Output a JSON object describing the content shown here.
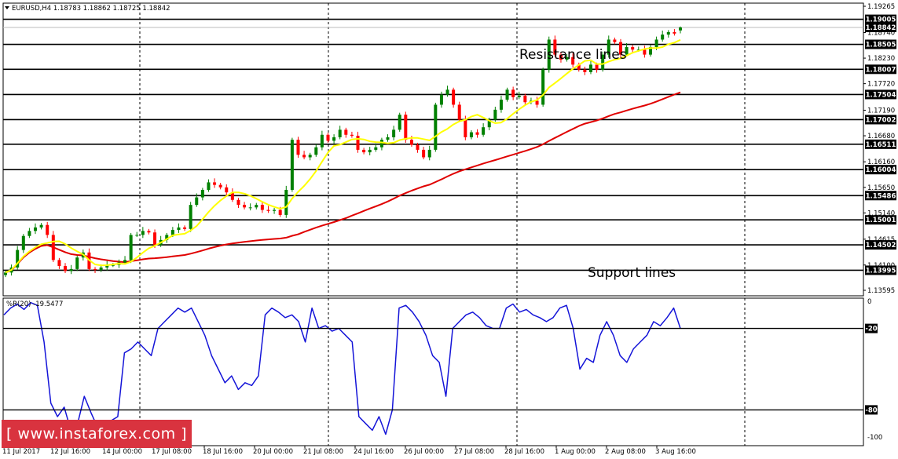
{
  "header": {
    "symbol_line": "EURUSD,H4  1.18783 1.18862 1.18725 1.18842"
  },
  "indicator": {
    "label": "%R(20) -19.5477"
  },
  "annotations": {
    "resistance": "Resistance lines",
    "support": "Support lines"
  },
  "watermark": {
    "text": "[  www.instaforex.com ]"
  },
  "colors": {
    "candle_up": "#008000",
    "candle_down": "#ff0000",
    "ma_fast": "#ffff00",
    "ma_slow": "#e00000",
    "wpr": "#1414d8",
    "watermark_bg": "#d9333f"
  },
  "chart_data": {
    "type": "candlestick",
    "symbol": "EURUSD",
    "timeframe": "H4",
    "last_ohlc": [
      1.18783,
      1.18862,
      1.18725,
      1.18842
    ],
    "ylim": [
      1.13595,
      1.19265
    ],
    "y_ticks": [
      1.19265,
      1.1874,
      1.1823,
      1.1772,
      1.1719,
      1.1668,
      1.1616,
      1.1565,
      1.1514,
      1.14615,
      1.141,
      1.13595
    ],
    "x_ticks": [
      "11 Jul 2017",
      "12 Jul 16:00",
      "14 Jul 00:00",
      "17 Jul 08:00",
      "18 Jul 16:00",
      "20 Jul 00:00",
      "21 Jul 08:00",
      "24 Jul 16:00",
      "26 Jul 00:00",
      "27 Jul 08:00",
      "28 Jul 16:00",
      "1 Aug 00:00",
      "2 Aug 08:00",
      "3 Aug 16:00"
    ],
    "levels": [
      1.19005,
      1.18842,
      1.18505,
      1.18007,
      1.17504,
      1.17002,
      1.16511,
      1.16004,
      1.15486,
      1.15001,
      1.14502,
      1.13995
    ],
    "close": [
      1.1395,
      1.1405,
      1.144,
      1.1468,
      1.1478,
      1.1485,
      1.149,
      1.147,
      1.142,
      1.1408,
      1.1398,
      1.1402,
      1.1425,
      1.1435,
      1.1402,
      1.14,
      1.1405,
      1.141,
      1.141,
      1.1415,
      1.142,
      1.147,
      1.147,
      1.1478,
      1.1475,
      1.145,
      1.146,
      1.147,
      1.148,
      1.1485,
      1.1482,
      1.153,
      1.1545,
      1.156,
      1.1575,
      1.157,
      1.1565,
      1.1555,
      1.154,
      1.153,
      1.1525,
      1.1525,
      1.153,
      1.152,
      1.1518,
      1.152,
      1.151,
      1.156,
      1.166,
      1.163,
      1.1625,
      1.163,
      1.1645,
      1.167,
      1.1658,
      1.1665,
      1.168,
      1.167,
      1.1668,
      1.164,
      1.1635,
      1.164,
      1.1645,
      1.166,
      1.1665,
      1.168,
      1.171,
      1.166,
      1.165,
      1.164,
      1.1625,
      1.164,
      1.173,
      1.175,
      1.176,
      1.173,
      1.17,
      1.1665,
      1.1675,
      1.167,
      1.1685,
      1.17,
      1.172,
      1.174,
      1.176,
      1.1745,
      1.1748,
      1.1735,
      1.1738,
      1.173,
      1.18,
      1.186,
      1.183,
      1.182,
      1.1825,
      1.181,
      1.18,
      1.1795,
      1.181,
      1.18,
      1.183,
      1.186,
      1.1855,
      1.183,
      1.1845,
      1.184,
      1.184,
      1.183,
      1.1845,
      1.186,
      1.187,
      1.1875,
      1.1872,
      1.18842
    ],
    "wpr": [
      -10,
      -5,
      -2,
      -6,
      -1,
      -3,
      -30,
      -75,
      -85,
      -78,
      -95,
      -90,
      -70,
      -82,
      -93,
      -92,
      -88,
      -85,
      -38,
      -35,
      -30,
      -35,
      -40,
      -20,
      -15,
      -10,
      -5,
      -8,
      -5,
      -15,
      -25,
      -40,
      -50,
      -60,
      -55,
      -65,
      -60,
      -62,
      -55,
      -10,
      -5,
      -8,
      -12,
      -10,
      -15,
      -30,
      -5,
      -20,
      -18,
      -22,
      -20,
      -25,
      -30,
      -85,
      -90,
      -95,
      -85,
      -98,
      -80,
      -5,
      -3,
      -8,
      -15,
      -25,
      -40,
      -45,
      -70,
      -20,
      -15,
      -10,
      -8,
      -12,
      -18,
      -20,
      -20,
      -5,
      -2,
      -8,
      -6,
      -10,
      -12,
      -15,
      -12,
      -5,
      -3,
      -20,
      -50,
      -42,
      -45,
      -25,
      -15,
      -25,
      -40,
      -45,
      -35,
      -30,
      -25,
      -15,
      -18,
      -12,
      -5,
      -20
    ]
  }
}
